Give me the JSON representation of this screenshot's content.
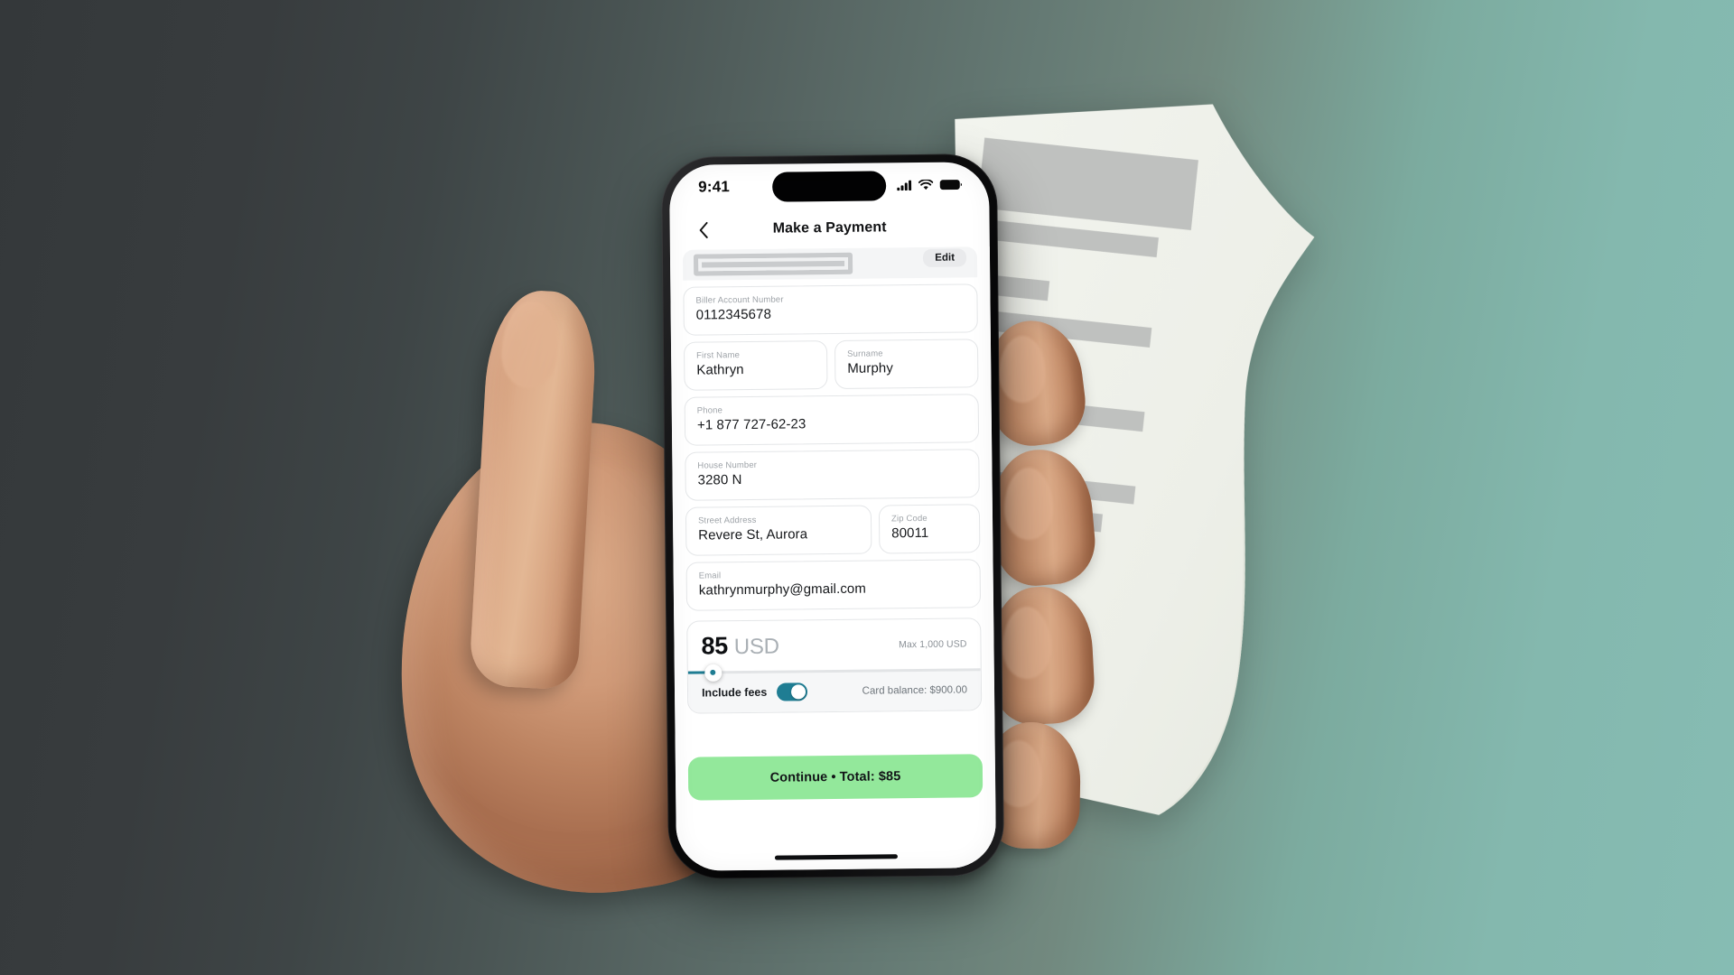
{
  "status_bar": {
    "time": "9:41",
    "icons": [
      "cellular-signal-icon",
      "wifi-icon",
      "battery-icon"
    ]
  },
  "nav": {
    "back_icon": "chevron-left-icon",
    "title": "Make a Payment"
  },
  "partial_card": {
    "edit_label": "Edit"
  },
  "fields": [
    {
      "label": "Biller Account Number",
      "value": "0112345678",
      "name": "biller-account-number"
    },
    {
      "label": "First Name",
      "value": "Kathryn",
      "name": "first-name"
    },
    {
      "label": "Surname",
      "value": "Murphy",
      "name": "surname"
    },
    {
      "label": "Phone",
      "value": "+1 877 727-62-23",
      "name": "phone"
    },
    {
      "label": "House Number",
      "value": "3280 N",
      "name": "house-number"
    },
    {
      "label": "Street Address",
      "value": "Revere St, Aurora",
      "name": "street-address"
    },
    {
      "label": "Zip Code",
      "value": "80011",
      "name": "zip-code"
    },
    {
      "label": "Email",
      "value": "kathrynmurphy@gmail.com",
      "name": "email"
    }
  ],
  "amount": {
    "value": "85",
    "currency": "USD",
    "max_label": "Max 1,000 USD",
    "slider_percent": 8.5
  },
  "fees": {
    "label": "Include fees",
    "toggle_on": true,
    "card_balance": "Card balance: $900.00"
  },
  "cta": {
    "label": "Continue • Total: $85"
  },
  "colors": {
    "accent_teal": "#1f7d93",
    "cta_green": "#93e89b",
    "background_dark": "#34383a",
    "background_teal": "#86bcb3",
    "paper": "#eef0e9",
    "paper_line": "#bfc1bf"
  },
  "background": {
    "paper_lines": 8
  }
}
